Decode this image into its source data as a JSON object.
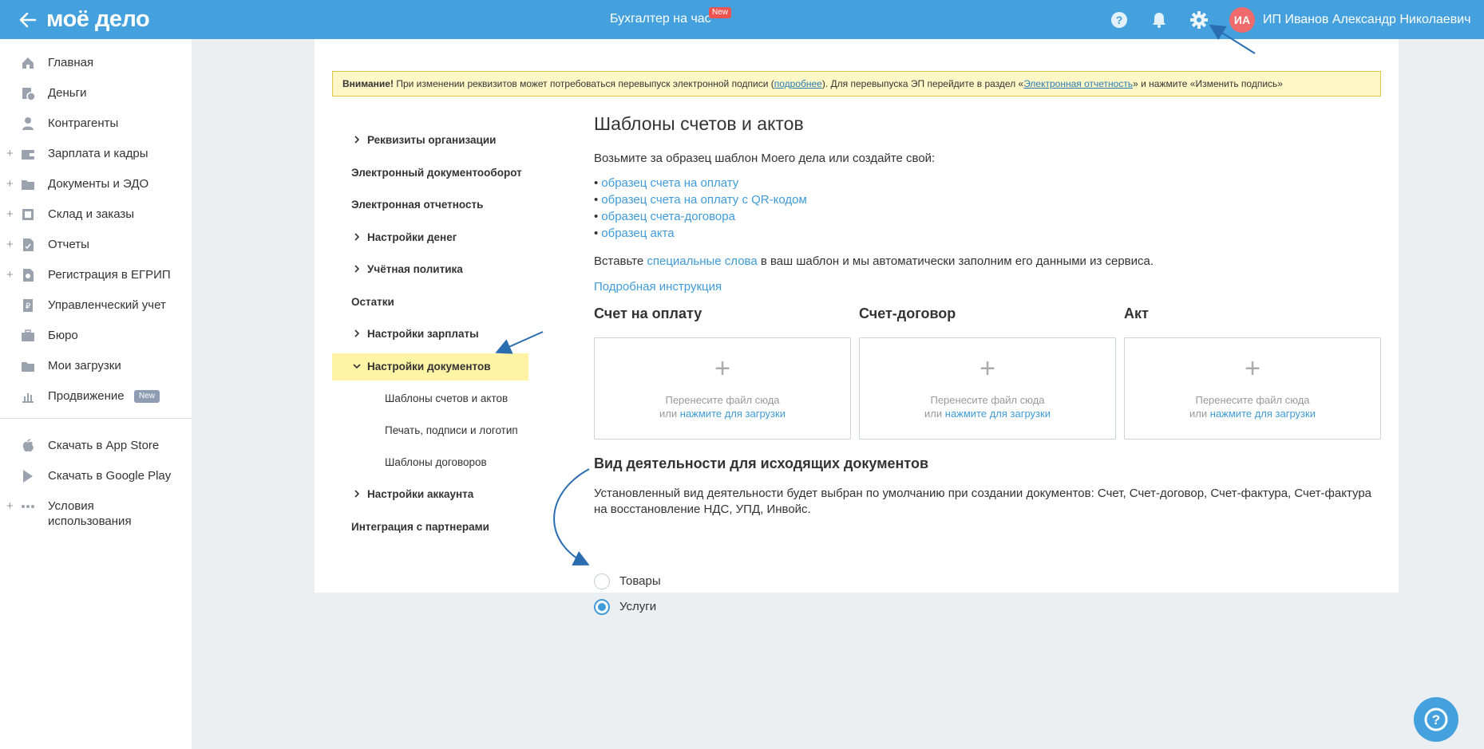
{
  "header": {
    "logo": "моё дело",
    "center_title": "Бухгалтер на час",
    "center_badge": "New",
    "avatar_initials": "ИА",
    "user_name": "ИП Иванов Александр Николаевич"
  },
  "sidebar": {
    "items": [
      {
        "label": "Главная",
        "icon": "home-icon",
        "plus": ""
      },
      {
        "label": "Деньги",
        "icon": "money-icon",
        "plus": ""
      },
      {
        "label": "Контрагенты",
        "icon": "contractor-icon",
        "plus": ""
      },
      {
        "label": "Зарплата и кадры",
        "icon": "wallet-icon",
        "plus": "+"
      },
      {
        "label": "Документы и ЭДО",
        "icon": "folder-icon",
        "plus": "+"
      },
      {
        "label": "Склад и заказы",
        "icon": "warehouse-icon",
        "plus": "+"
      },
      {
        "label": "Отчеты",
        "icon": "report-icon",
        "plus": "+"
      },
      {
        "label": "Регистрация в ЕГРИП",
        "icon": "registration-icon",
        "plus": "+"
      },
      {
        "label": "Управленческий учет",
        "icon": "management-icon",
        "plus": ""
      },
      {
        "label": "Бюро",
        "icon": "briefcase-icon",
        "plus": ""
      },
      {
        "label": "Мои загрузки",
        "icon": "downloads-folder-icon",
        "plus": ""
      },
      {
        "label": "Продвижение",
        "icon": "chart-icon",
        "plus": "",
        "badge": "New"
      }
    ],
    "bottom_items": [
      {
        "label": "Скачать в App Store",
        "icon": "apple-icon"
      },
      {
        "label": "Скачать в Google Play",
        "icon": "google-play-icon"
      },
      {
        "label_line1": "Условия",
        "label_line2": "использования",
        "icon": "more-dots-icon",
        "plus": "+"
      }
    ]
  },
  "warning": {
    "bold": "Внимание!",
    "text1": " При изменении реквизитов может потребоваться перевыпуск электронной подписи (",
    "link1": "подробнее",
    "text2": "). Для перевыпуска ЭП перейдите в раздел «",
    "link2": "Электронная отчетность",
    "text3": "» и нажмите «Изменить подпись»"
  },
  "settings_nav": {
    "items": [
      {
        "label": "Реквизиты организации",
        "chevron": true
      },
      {
        "label": "Электронный документооборот",
        "chevron": false
      },
      {
        "label": "Электронная отчетность",
        "chevron": false
      },
      {
        "label": "Настройки денег",
        "chevron": true
      },
      {
        "label": "Учётная политика",
        "chevron": true
      },
      {
        "label": "Остатки",
        "chevron": false
      },
      {
        "label": "Настройки зарплаты",
        "chevron": true
      },
      {
        "label": "Настройки документов",
        "chevron": true,
        "active": true
      }
    ],
    "sub_items": [
      "Шаблоны счетов и актов",
      "Печать, подписи и логотип",
      "Шаблоны договоров"
    ],
    "items_after": [
      {
        "label": "Настройки аккаунта",
        "chevron": true
      },
      {
        "label": "Интеграция с партнерами",
        "chevron": false
      }
    ]
  },
  "main": {
    "title": "Шаблоны счетов и актов",
    "intro": "Возьмите за образец шаблон Моего дела или создайте свой:",
    "samples": [
      "образец счета на оплату",
      "образец счета на оплату с QR-кодом",
      "образец счета-договора",
      "образец акта"
    ],
    "insert_text_before": "Вставьте ",
    "insert_link": "специальные слова",
    "insert_text_after": " в ваш шаблон и мы автоматически заполним его данными из сервиса.",
    "instruction_link": "Подробная инструкция",
    "columns": [
      {
        "title": "Счет на оплату"
      },
      {
        "title": "Счет-договор"
      },
      {
        "title": "Акт"
      }
    ],
    "dropzone": {
      "plus": "+",
      "line1": "Перенесите файл сюда",
      "line2_prefix": "или ",
      "line2_link": "нажмите для загрузки"
    },
    "activity_title": "Вид деятельности для исходящих документов",
    "activity_desc_line1": "Установленный вид деятельности будет выбран по умолчанию при создании документов: Счет, Счет-договор, Счет-фактура, Счет-фактура",
    "activity_desc_line2": "на восстановление НДС, УПД, Инвойс.",
    "radio_options": [
      {
        "label": "Товары",
        "checked": false
      },
      {
        "label": "Услуги",
        "checked": true
      }
    ]
  },
  "colors": {
    "header_bg": "#44a1dd",
    "link": "#3f9bd9",
    "active_nav": "#fff3a6",
    "warning_bg": "#fff8c6",
    "annotation_arrow": "#2a6db0"
  }
}
